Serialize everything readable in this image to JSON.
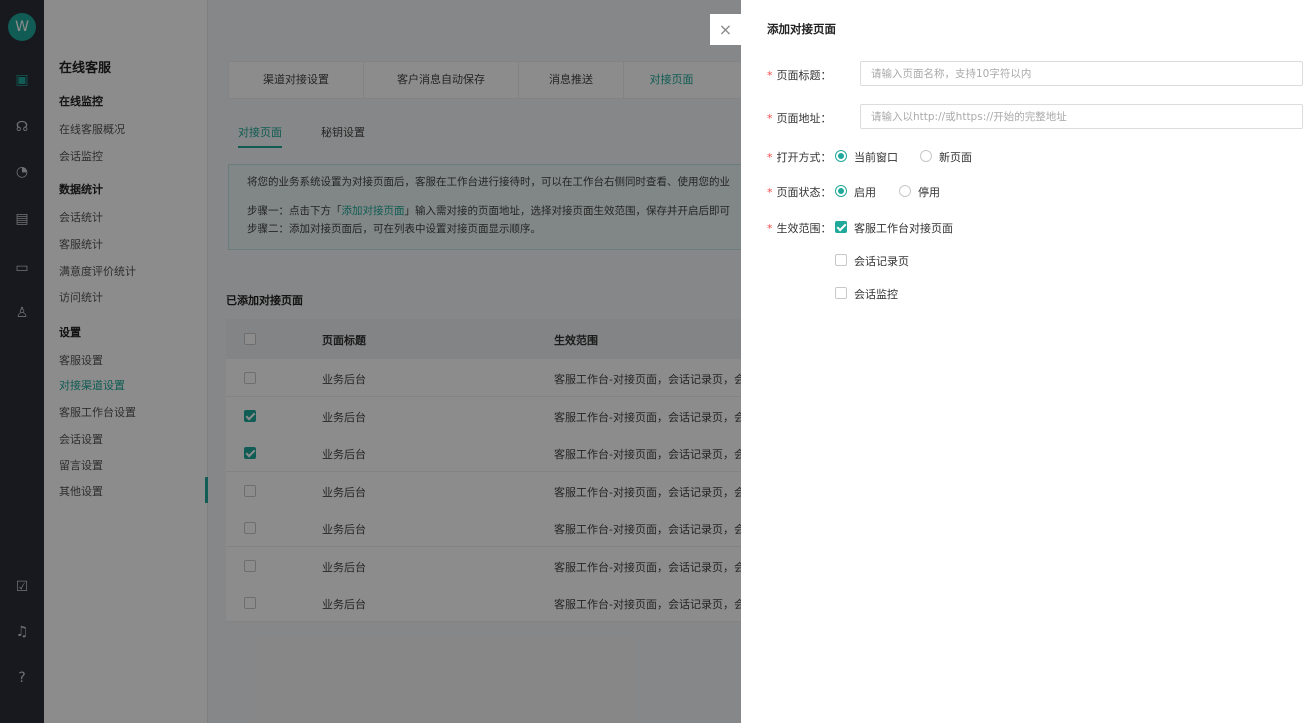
{
  "rail": {
    "logo_glyph": "W",
    "icons": [
      "chat-icon",
      "headset-icon",
      "dashboard-icon",
      "monitor-icon",
      "screen-icon",
      "user-settings-icon",
      "report-icon",
      "bell-icon",
      "help-icon"
    ]
  },
  "submenu": {
    "title": "在线客服",
    "group1": "在线监控",
    "group1_items": [
      "在线客服概况",
      "会话监控"
    ],
    "group2": "数据统计",
    "group2_items": [
      "会话统计",
      "客服统计",
      "满意度评价统计",
      "访问统计"
    ],
    "group3": "设置",
    "group3_items": [
      "客服设置",
      "对接渠道设置",
      "客服工作台设置",
      "会话设置",
      "留言设置",
      "其他设置"
    ]
  },
  "main": {
    "tabs": [
      "渠道对接设置",
      "客户消息自动保存",
      "消息推送",
      "对接页面"
    ],
    "subtabs": [
      "对接页面",
      "秘钥设置"
    ],
    "notice": {
      "line1": "将您的业务系统设置为对接页面后，客服在工作台进行接待时，可以在工作台右侧同时查看、使用您的业",
      "line2_pre": "步骤一：点击下方「",
      "line2_hl": "添加对接页面",
      "line2_post": "」输入需对接的页面地址，选择对接页面生效范围，保存并开启后即可",
      "line3": "步骤二：添加对接页面后，可在列表中设置对接页面显示顺序。"
    },
    "section_title": "已添加对接页面",
    "table": {
      "headers": [
        "页面标题",
        "生效范围"
      ],
      "rows": [
        {
          "title": "业务后台",
          "scope": "客服工作台-对接页面，会话记录页，会",
          "checked": false
        },
        {
          "title": "业务后台",
          "scope": "客服工作台-对接页面，会话记录页，会",
          "checked": true
        },
        {
          "title": "业务后台",
          "scope": "客服工作台-对接页面，会话记录页，会",
          "checked": true
        },
        {
          "title": "业务后台",
          "scope": "客服工作台-对接页面，会话记录页，会",
          "checked": false
        },
        {
          "title": "业务后台",
          "scope": "客服工作台-对接页面，会话记录页，会",
          "checked": false
        },
        {
          "title": "业务后台",
          "scope": "客服工作台-对接页面，会话记录页，会",
          "checked": false
        },
        {
          "title": "业务后台",
          "scope": "客服工作台-对接页面，会话记录页，会",
          "checked": false
        }
      ]
    }
  },
  "drawer": {
    "close_glyph": "×",
    "title": "添加对接页面",
    "required_mark": "*",
    "page_title_label": "页面标题：",
    "page_title_placeholder": "请输入页面名称，支持10字符以内",
    "page_url_label": "页面地址：",
    "page_url_placeholder": "请输入以http://或https://开始的完整地址",
    "open_mode_label": "打开方式：",
    "open_mode_options": [
      "当前窗口",
      "新页面"
    ],
    "open_mode_selected": 0,
    "status_label": "页面状态：",
    "status_options": [
      "启用",
      "停用"
    ],
    "status_selected": 0,
    "scope_label": "生效范围：",
    "scope_options": [
      {
        "label": "客服工作台对接页面",
        "checked": true
      },
      {
        "label": "会话记录页",
        "checked": false
      },
      {
        "label": "会话监控",
        "checked": false
      }
    ]
  },
  "colors": {
    "accent": "#20a89a",
    "required": "#f04a4a",
    "overlay": "rgba(0,0,0,0.45)"
  }
}
